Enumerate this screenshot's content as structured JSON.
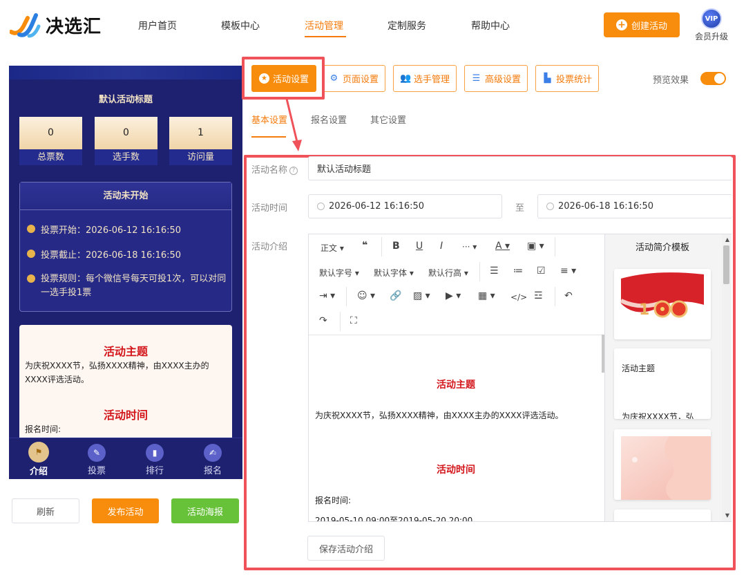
{
  "brand": {
    "name": "决选汇"
  },
  "nav": {
    "items": [
      {
        "label": "用户首页",
        "active": false
      },
      {
        "label": "模板中心",
        "active": false
      },
      {
        "label": "活动管理",
        "active": true
      },
      {
        "label": "定制服务",
        "active": false
      },
      {
        "label": "帮助中心",
        "active": false
      }
    ],
    "create_label": "创建活动",
    "vip_badge": "VIP",
    "vip_label": "会员升级"
  },
  "preview": {
    "title": "默认活动标题",
    "stats": [
      {
        "value": "0",
        "label": "总票数"
      },
      {
        "value": "0",
        "label": "选手数"
      },
      {
        "value": "1",
        "label": "访问量"
      }
    ],
    "status_title": "活动未开始",
    "vote_start": "投票开始：2026-06-12 16:16:50",
    "vote_end": "投票截止：2026-06-18 16:16:50",
    "vote_rule": "投票规则：每个微信号每天可投1次，可以对同一选手投1票",
    "intro_heading1": "活动主题",
    "intro_text1": "为庆祝XXXX节，弘扬XXXX精神，由XXXX主办的XXXX评选活动。",
    "intro_heading2": "活动时间",
    "intro_text2": "报名时间:",
    "tabbar": [
      {
        "label": "介绍",
        "active": true
      },
      {
        "label": "投票",
        "active": false
      },
      {
        "label": "排行",
        "active": false
      },
      {
        "label": "报名",
        "active": false
      }
    ]
  },
  "actions": {
    "refresh": "刷新",
    "publish": "发布活动",
    "poster": "活动海报"
  },
  "settings_tabs": [
    {
      "label": "活动设置",
      "icon": "star-icon",
      "active": true
    },
    {
      "label": "页面设置",
      "icon": "gear-icon",
      "active": false
    },
    {
      "label": "选手管理",
      "icon": "users-icon",
      "active": false
    },
    {
      "label": "高级设置",
      "icon": "sliders-icon",
      "active": false
    },
    {
      "label": "投票统计",
      "icon": "bar-chart-icon",
      "active": false
    }
  ],
  "preview_toggle": {
    "label": "预览效果",
    "on": true
  },
  "sub_tabs": [
    {
      "label": "基本设置",
      "active": true
    },
    {
      "label": "报名设置",
      "active": false
    },
    {
      "label": "其它设置",
      "active": false
    }
  ],
  "form": {
    "name_label": "活动名称",
    "name_value": "默认活动标题",
    "time_label": "活动时间",
    "start_time": "2026-06-12 16:16:50",
    "to_label": "至",
    "end_time": "2026-06-18 16:16:50",
    "intro_label": "活动介绍",
    "save_label": "保存活动介绍"
  },
  "editor": {
    "toolbar": {
      "paragraph": "正文",
      "font_size": "默认字号",
      "font_family": "默认字体",
      "line_height": "默认行高"
    },
    "content": {
      "heading1": "活动主题",
      "text1": "为庆祝XXXX节，弘扬XXXX精神，由XXXX主办的XXXX评选活动。",
      "heading2": "活动时间",
      "text2": "报名时间:",
      "text3": "2019-05-10 09:00至2019-05-20 20:00"
    }
  },
  "templates": {
    "title": "活动简介模板",
    "card2_title": "活动主题",
    "card2_text": "为庆祝XXXX节，弘"
  }
}
